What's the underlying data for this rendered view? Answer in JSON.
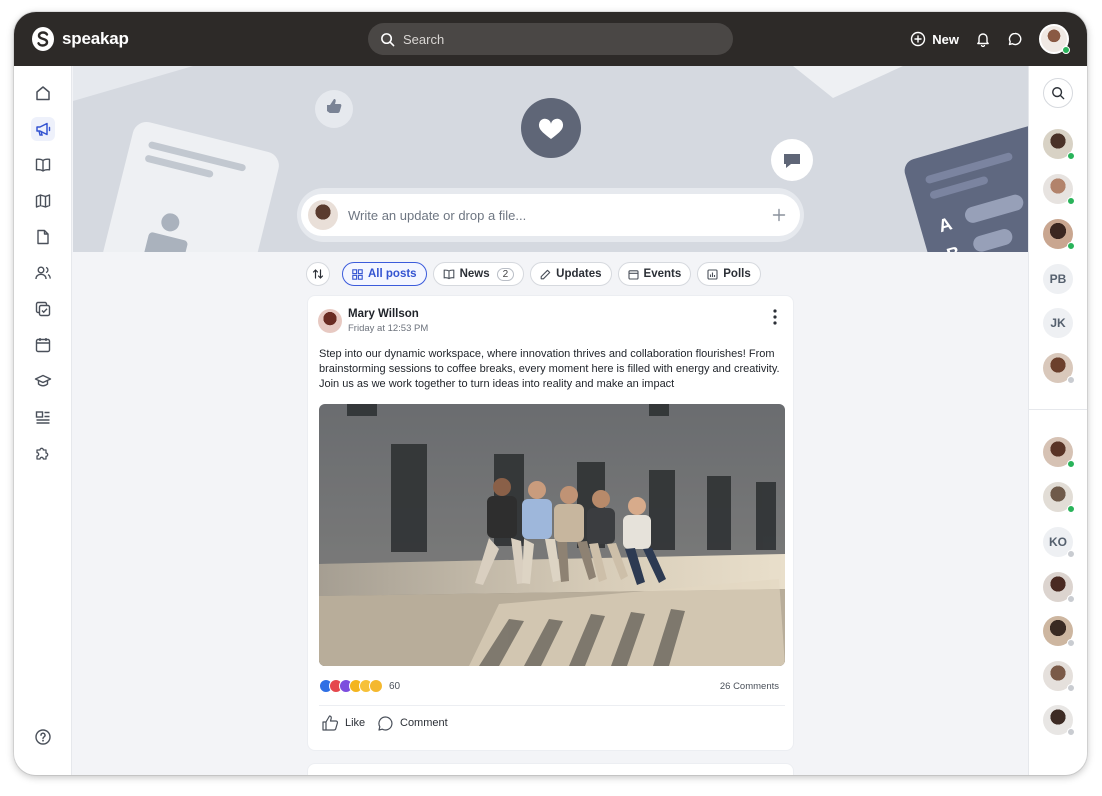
{
  "app": {
    "name": "speakap"
  },
  "search": {
    "placeholder": "Search"
  },
  "header": {
    "new_label": "New"
  },
  "composer": {
    "placeholder": "Write an update or drop a file..."
  },
  "filters": [
    {
      "label": "All posts",
      "active": true
    },
    {
      "label": "News",
      "count": "2"
    },
    {
      "label": "Updates"
    },
    {
      "label": "Events"
    },
    {
      "label": "Polls"
    }
  ],
  "post": {
    "author": "Mary Willson",
    "time": "Friday at 12:53 PM",
    "text": "Step into our dynamic workspace, where innovation thrives and collaboration flourishes! From brainstorming sessions to coffee breaks, every moment here is filled with energy and creativity. Join us as we work together to turn ideas into reality and make an impact",
    "reaction_count": "60",
    "comments": "26 Comments",
    "like_label": "Like",
    "comment_label": "Comment"
  },
  "sidebar": {
    "items": [
      "home-icon",
      "megaphone-icon",
      "book-icon",
      "map-icon",
      "file-icon",
      "people-icon",
      "tasks-icon",
      "calendar-icon",
      "graduation-icon",
      "form-icon",
      "puzzle-icon"
    ],
    "help": "help-icon"
  },
  "people": {
    "initials": [
      "PB",
      "JK",
      "KO"
    ]
  },
  "colors": {
    "topbar": "#2d2a28",
    "accent": "#3454d1",
    "online": "#29b35a",
    "hero": "#d5d9e0"
  }
}
